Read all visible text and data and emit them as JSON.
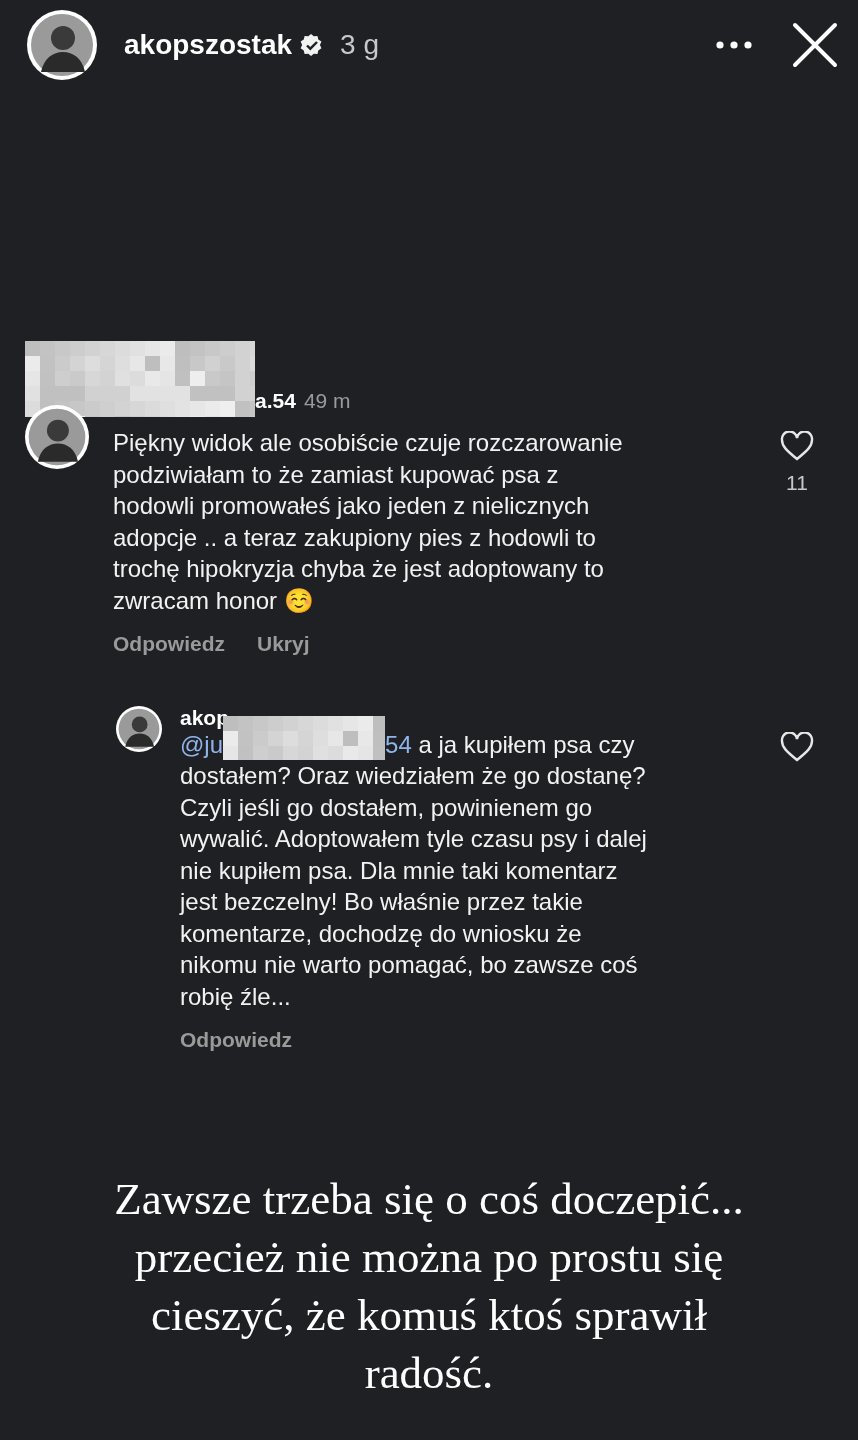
{
  "story": {
    "author": "akopszostak",
    "verified": true,
    "time": "3 g"
  },
  "comment": {
    "author": "a.54",
    "time": "49 m",
    "lines": [
      "Piękny widok ale osobiście czuje rozczarowanie",
      "podziwiałam to że zamiast kupować psa z",
      "hodowli promowałeś jako jeden z nielicznych",
      "adopcje .. a teraz zakupiony pies z hodowli to",
      "trochę hipokryzja chyba że jest adoptowany to",
      "zwracam honor ☺️"
    ],
    "liked": false,
    "likes": "11",
    "actions": [
      "Odpowiedz",
      "Ukryj"
    ]
  },
  "reply": {
    "author": "akop",
    "mention_start": "@ju",
    "mention_end": "54",
    "lines": [
      " a ja kupiłem psa czy",
      "dostałem? Oraz wiedziałem że go dostanę?",
      "Czyli jeśli go dostałem, powinienem go",
      "wywalić. Adoptowałem tyle czasu psy i dalej",
      "nie kupiłem psa. Dla mnie taki komentarz",
      "jest bezczelny! Bo właśnie przez takie",
      "komentarze, dochodzę do wniosku że",
      "nikomu nie warto pomagać, bo zawsze coś",
      "robię źle..."
    ],
    "liked": false,
    "actions": [
      "Odpowiedz"
    ]
  },
  "caption": [
    "Zawsze trzeba się o coś doczepić...",
    "przecież nie można po prostu się",
    "cieszyć, że komuś ktoś sprawił",
    "radość."
  ]
}
